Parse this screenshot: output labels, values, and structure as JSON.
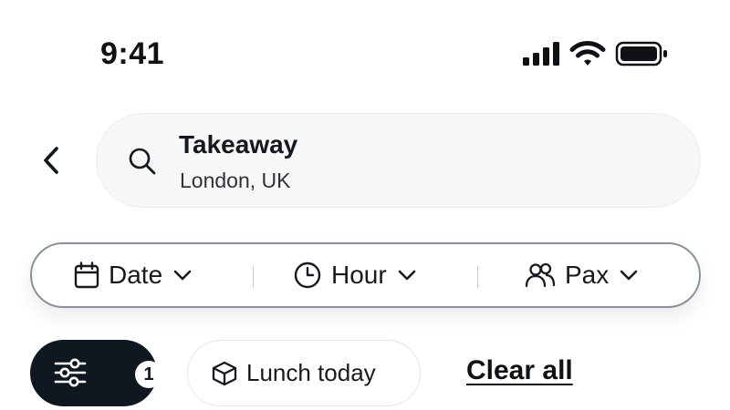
{
  "status_bar": {
    "time": "9:41",
    "icons": [
      "cellular-signal-icon",
      "wifi-icon",
      "battery-icon"
    ]
  },
  "search": {
    "back_icon": "chevron-left-icon",
    "search_icon": "search-icon",
    "title": "Takeaway",
    "subtitle": "London, UK"
  },
  "booking": {
    "date_label": "Date",
    "hour_label": "Hour",
    "pax_label": "Pax",
    "icons": [
      "calendar-icon",
      "clock-icon",
      "people-icon",
      "chevron-down-icon"
    ]
  },
  "filters": {
    "active_count": "1",
    "filter_icon": "sliders-icon",
    "chip_label": "Lunch today",
    "chip_icon": "takeaway-box-icon",
    "clear_label": "Clear all"
  },
  "colors": {
    "dark": "#0f1820",
    "search_bg": "#f7f7f7",
    "pill_border": "#8b9096"
  }
}
